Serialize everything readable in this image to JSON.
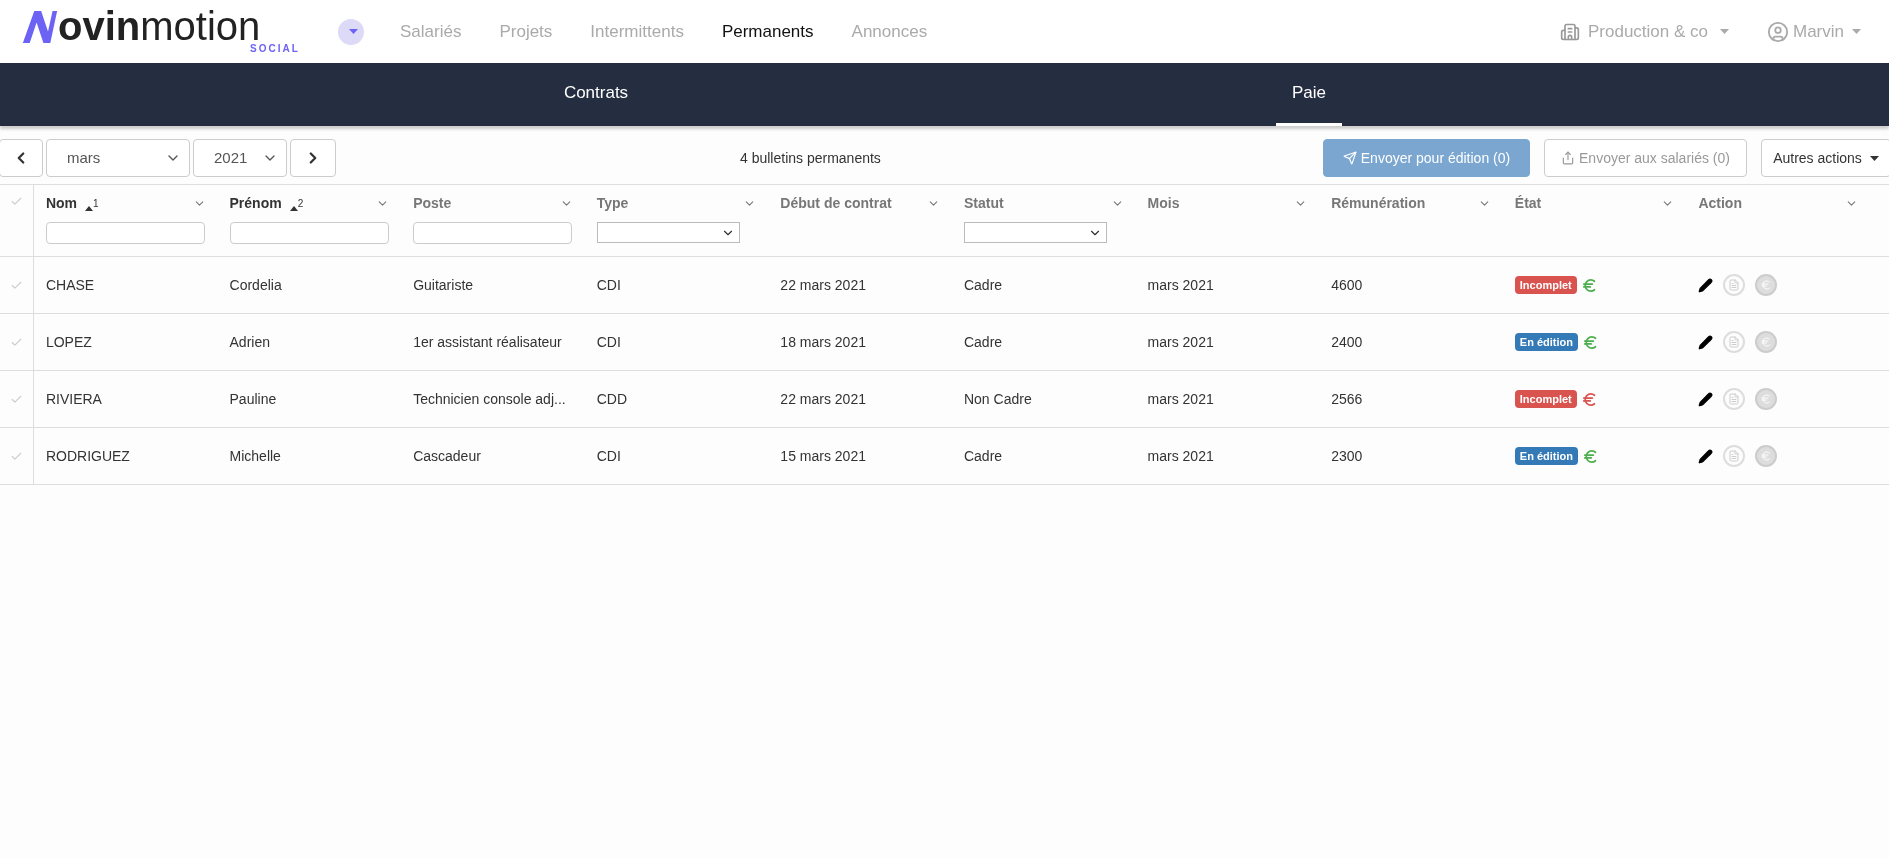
{
  "logo": {
    "bold": "ovin",
    "light": "motion",
    "tagline": "SOCIAL"
  },
  "nav": [
    {
      "label": "Salariés",
      "selected": false
    },
    {
      "label": "Projets",
      "selected": false
    },
    {
      "label": "Intermittents",
      "selected": false
    },
    {
      "label": "Permanents",
      "selected": true
    },
    {
      "label": "Annonces",
      "selected": false
    }
  ],
  "company": "Production & co",
  "user": "Marvin",
  "subtabs": [
    {
      "label": "Contrats",
      "selected": false
    },
    {
      "label": "Paie",
      "selected": true
    }
  ],
  "toolbar": {
    "month": "mars",
    "year": "2021",
    "count": "4 bulletins permanents",
    "buttons": [
      {
        "label": "Envoyer pour édition (0)",
        "kind": "primary"
      },
      {
        "label": "Envoyer aux salariés (0)",
        "kind": "disabled"
      },
      {
        "label": "Autres actions",
        "kind": "dropdown"
      }
    ]
  },
  "columns": [
    {
      "label": "Nom",
      "sort": "1",
      "kind": "text"
    },
    {
      "label": "Prénom",
      "sort": "2",
      "kind": "text"
    },
    {
      "label": "Poste",
      "kind": "text"
    },
    {
      "label": "Type",
      "kind": "select"
    },
    {
      "label": "Début de contrat",
      "kind": "plain"
    },
    {
      "label": "Statut",
      "kind": "select"
    },
    {
      "label": "Mois",
      "kind": "plain"
    },
    {
      "label": "Rémunération",
      "kind": "plain"
    },
    {
      "label": "État",
      "kind": "plain"
    },
    {
      "label": "Action",
      "kind": "plain"
    }
  ],
  "rows": [
    {
      "cells": [
        "CHASE",
        "Cordelia",
        "Guitariste",
        "CDI",
        "22 mars 2021",
        "Cadre",
        "mars 2021",
        "4600"
      ],
      "state": {
        "label": "Incomplet",
        "kind": "incomplete"
      },
      "euro_ok": true
    },
    {
      "cells": [
        "LOPEZ",
        "Adrien",
        "1er assistant réalisateur",
        "CDI",
        "18 mars 2021",
        "Cadre",
        "mars 2021",
        "2400"
      ],
      "state": {
        "label": "En édition",
        "kind": "editing"
      },
      "euro_ok": true
    },
    {
      "cells": [
        "RIVIERA",
        "Pauline",
        "Technicien console adj...",
        "CDD",
        "22 mars 2021",
        "Non Cadre",
        "mars 2021",
        "2566"
      ],
      "state": {
        "label": "Incomplet",
        "kind": "incomplete"
      },
      "euro_ok": false
    },
    {
      "cells": [
        "RODRIGUEZ",
        "Michelle",
        "Cascadeur",
        "CDI",
        "15 mars 2021",
        "Cadre",
        "mars 2021",
        "2300"
      ],
      "state": {
        "label": "En édition",
        "kind": "editing"
      },
      "euro_ok": true
    }
  ]
}
